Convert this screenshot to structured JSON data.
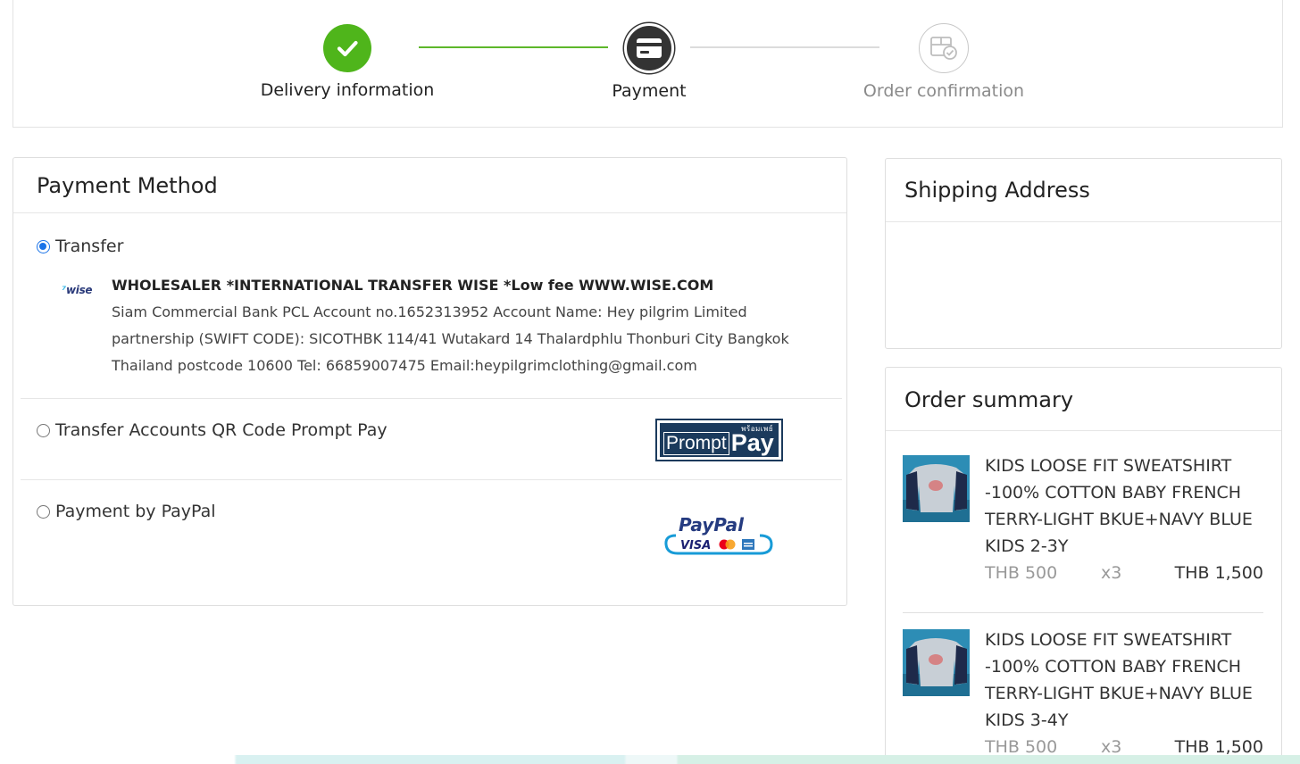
{
  "stepper": {
    "steps": [
      {
        "label": "Delivery information",
        "state": "completed"
      },
      {
        "label": "Payment",
        "state": "active"
      },
      {
        "label": "Order confirmation",
        "state": "pending"
      }
    ]
  },
  "payment": {
    "title": "Payment Method",
    "options": [
      {
        "label": "Transfer",
        "selected": true,
        "logo": "wise",
        "logo_text": "wise",
        "bank_title": "WHOLESALER *INTERNATIONAL TRANSFER WISE *Low fee WWW.WISE.COM",
        "bank_desc": "Siam Commercial Bank PCL Account no.1652313952 Account Name: Hey pilgrim Limited partnership (SWIFT CODE): SICOTHBK 114/41 Wutakard 14 Thalardphlu Thonburi City Bangkok Thailand postcode 10600 Tel: 66859007475 Email:heypilgrimclothing@gmail.com"
      },
      {
        "label": "Transfer Accounts QR Code Prompt Pay",
        "selected": false,
        "logo": "promptpay",
        "logo_thai": "พร้อมเพย์",
        "logo_prompt": "Prompt",
        "logo_pay": "Pay"
      },
      {
        "label": "Payment by PayPal",
        "selected": false,
        "logo": "paypal",
        "logo_paypal": "PayPal",
        "logo_visa": "VISA"
      }
    ]
  },
  "shipping": {
    "title": "Shipping Address"
  },
  "summary": {
    "title": "Order summary",
    "items": [
      {
        "name": "KIDS LOOSE FIT SWEATSHIRT -100% COTTON BABY FRENCH TERRY-LIGHT BKUE+NAVY BLUE KIDS 2-3Y",
        "unit_price": "THB 500",
        "quantity": "x3",
        "total": "THB 1,500"
      },
      {
        "name": "KIDS LOOSE FIT SWEATSHIRT -100% COTTON BABY FRENCH TERRY-LIGHT BKUE+NAVY BLUE KIDS 3-4Y",
        "unit_price": "THB 500",
        "quantity": "x3",
        "total": "THB 1,500"
      }
    ]
  },
  "colors": {
    "completed": "#4fb51b",
    "active": "#333333",
    "accent_radio": "#1a73e8",
    "promptpay_navy": "#1b3a5c",
    "paypal_blue": "#253b80",
    "paypal_light": "#179bd7"
  }
}
